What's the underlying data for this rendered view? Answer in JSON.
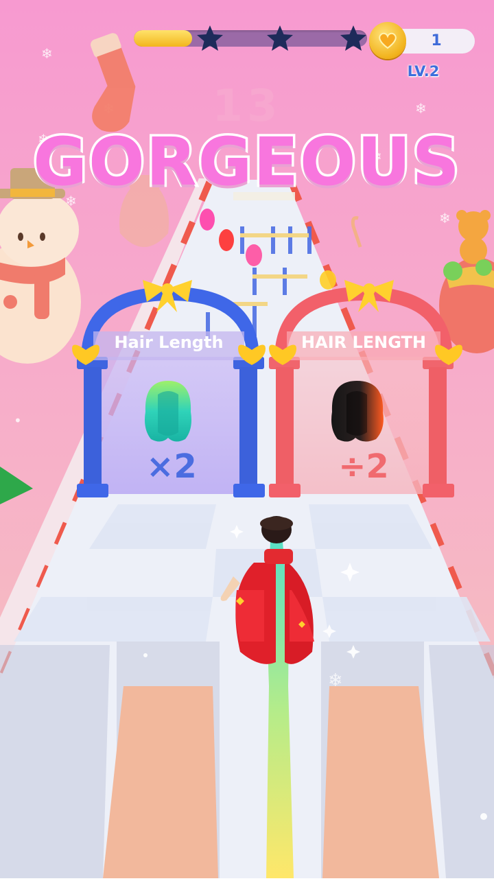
{
  "hud": {
    "progress_percent": 25,
    "stars_total": 3,
    "coins": "1",
    "level": "LV.2"
  },
  "combo": {
    "count": "13",
    "rating": "GORGEOUS"
  },
  "gates": [
    {
      "label": "Hair Length",
      "operation": "×2",
      "frame_color": "#3f67e8",
      "panel_color": "#b7a6f2",
      "op_color": "#4b6de0"
    },
    {
      "label": "HAIR LENGTH",
      "operation": "÷2",
      "frame_color": "#f2606a",
      "panel_color": "#f7b1bb",
      "op_color": "#f06a6f"
    }
  ],
  "colors": {
    "sky_top": "#f79ad0",
    "sky_bottom": "#f6c4c4",
    "heart": "#ffc824",
    "ribbon": "#ffd12e",
    "star": "#1d2b5a"
  }
}
